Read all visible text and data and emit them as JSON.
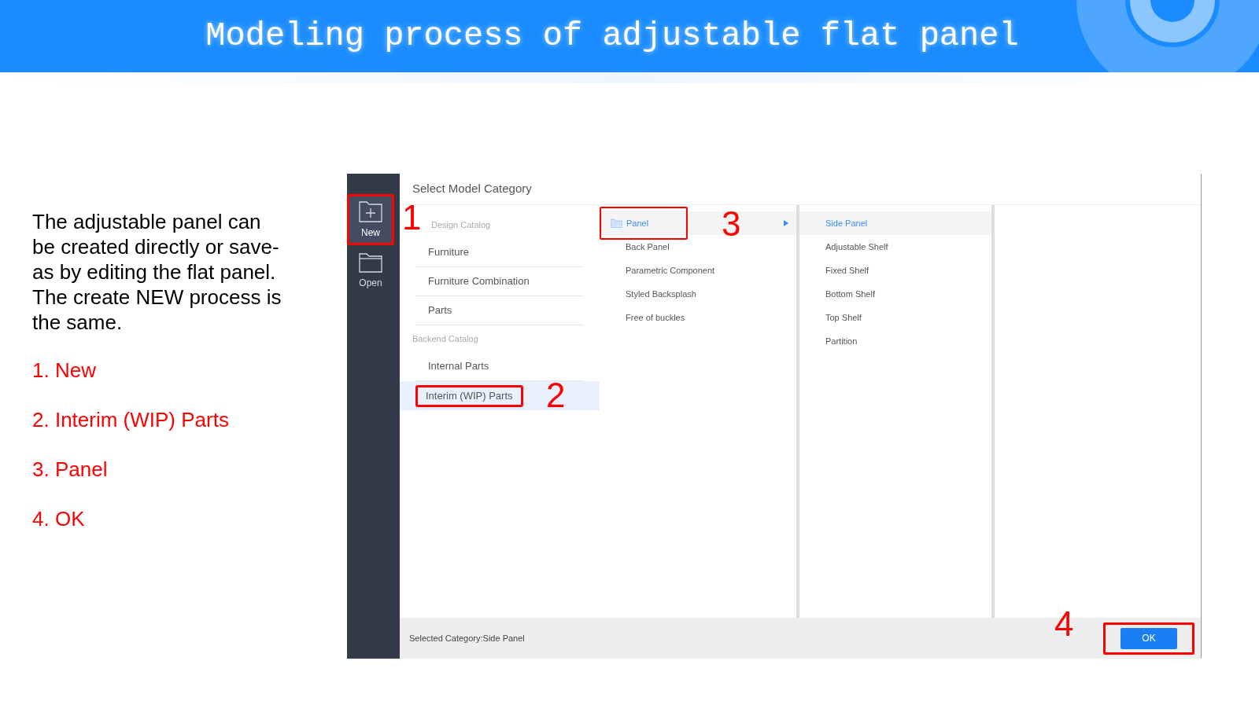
{
  "header": {
    "title": "Modeling process of adjustable flat panel"
  },
  "description": "The adjustable panel can be created directly or save-as by editing the flat panel. The create NEW process is the same.",
  "steps": [
    "1. New",
    "2. Interim (WIP) Parts",
    "3. Panel",
    "4. OK"
  ],
  "app": {
    "sidebar": [
      {
        "label": "New",
        "selected": true,
        "highlighted": true,
        "callout": "1"
      },
      {
        "label": "Open",
        "selected": false,
        "highlighted": false
      }
    ],
    "dialog_title": "Select Model Category",
    "catalogs": [
      {
        "heading": "Design Catalog",
        "items": [
          {
            "label": "Furniture",
            "selected": false,
            "highlighted": false
          },
          {
            "label": "Furniture Combination",
            "selected": false,
            "highlighted": false
          },
          {
            "label": "Parts",
            "selected": false,
            "highlighted": false
          }
        ]
      },
      {
        "heading": "Backend Catalog",
        "items": [
          {
            "label": "Internal Parts",
            "selected": false,
            "highlighted": false
          },
          {
            "label": "Interim (WIP) Parts",
            "selected": true,
            "highlighted": true,
            "callout": "2"
          }
        ]
      }
    ],
    "subcategories": [
      {
        "label": "Panel",
        "selected": true,
        "highlighted": true,
        "callout": "3",
        "has_children": true
      },
      {
        "label": "Back Panel",
        "selected": false,
        "highlighted": false,
        "has_children": false
      },
      {
        "label": "Parametric Component",
        "selected": false,
        "highlighted": false,
        "has_children": false
      },
      {
        "label": "Styled Backsplash",
        "selected": false,
        "highlighted": false,
        "has_children": false
      },
      {
        "label": "Free of buckles",
        "selected": false,
        "highlighted": false,
        "has_children": false
      }
    ],
    "types": [
      {
        "label": "Side Panel",
        "selected": true
      },
      {
        "label": "Adjustable Shelf",
        "selected": false
      },
      {
        "label": "Fixed Shelf",
        "selected": false
      },
      {
        "label": "Bottom Shelf",
        "selected": false
      },
      {
        "label": "Top Shelf",
        "selected": false
      },
      {
        "label": "Partition",
        "selected": false
      }
    ],
    "status": "Selected Category:Side Panel",
    "ok_button": {
      "label": "OK",
      "highlighted": true,
      "callout": "4"
    }
  }
}
